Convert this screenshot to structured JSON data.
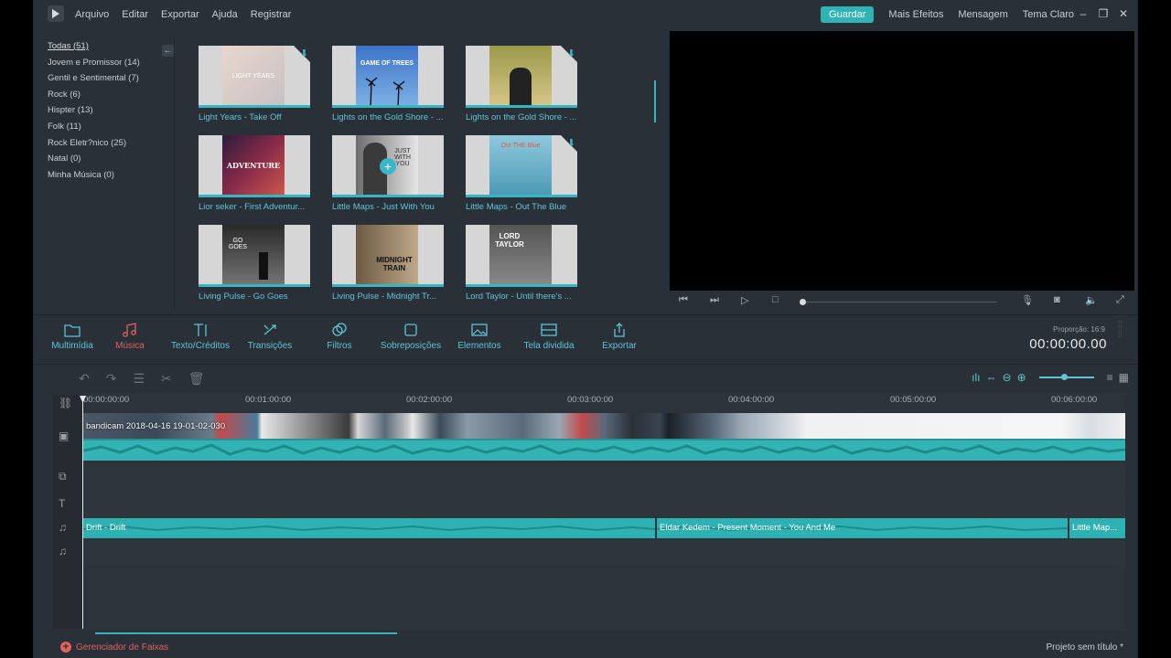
{
  "menu": [
    "Arquivo",
    "Editar",
    "Exportar",
    "Ajuda",
    "Registrar"
  ],
  "right_menu": {
    "save": "Guardar",
    "more_effects": "Mais Efeitos",
    "message": "Mensagem",
    "theme": "Tema Claro"
  },
  "categories": [
    "Todas (51)",
    "Jovem e Promissor (14)",
    "Gentil e Sentimental (7)",
    "Rock (6)",
    "Hispter (13)",
    "Folk (11)",
    "Rock Eletr?nico (25)",
    "Natal (0)",
    "Minha Música (0)"
  ],
  "tracks": [
    {
      "title": "Light Years - Take Off",
      "cover_text": "LIGHT YEARS"
    },
    {
      "title": "Lights on the Gold Shore - ...",
      "cover_text": "GAME OF TREES"
    },
    {
      "title": "Lights on the Gold Shore - ...",
      "cover_text": ""
    },
    {
      "title": "Lior seker - First Adventur...",
      "cover_text": "ADVENTURE"
    },
    {
      "title": "Little Maps - Just With You",
      "cover_text": "JUST WITH YOU"
    },
    {
      "title": "Little Maps - Out The Blue",
      "cover_text": "Out THE Blue"
    },
    {
      "title": "Living Pulse - Go Goes",
      "cover_text": "GO GOES"
    },
    {
      "title": "Living Pulse - Midnight Tr...",
      "cover_text": "MIDNIGHT TRAIN"
    },
    {
      "title": "Lord Taylor - Until there's ...",
      "cover_text": "LORD TAYLOR"
    }
  ],
  "toolbar": {
    "multimedia": "Multimídia",
    "music": "Música",
    "text": "Texto/Créditos",
    "transitions": "Transições",
    "filters": "Filtros",
    "overlays": "Sobreposições",
    "elements": "Elementos",
    "split": "Tela dividida",
    "export": "Exportar"
  },
  "preview": {
    "ratio": "Proporção: 16:9",
    "timecode": "00:00:00.00"
  },
  "ruler": [
    "00:00:00:00",
    "00:01:00:00",
    "00:02:00:00",
    "00:03:00:00",
    "00:04:00:00",
    "00:05:00:00",
    "00:06:00:00"
  ],
  "video_clip": {
    "label": "bandicam 2018-04-16 19-01-02-030"
  },
  "audio_clips": [
    {
      "label": "Drift - Drift"
    },
    {
      "label": "Eldar Kedem - Present Moment - You And Me"
    },
    {
      "label": "Little Map..."
    }
  ],
  "footer": {
    "track_manager": "Gerenciador de Faixas",
    "project": "Projeto sem título *"
  },
  "colors": {
    "accent": "#2fb3b3",
    "active_tab": "#e0625a",
    "background": "#2a3038"
  }
}
